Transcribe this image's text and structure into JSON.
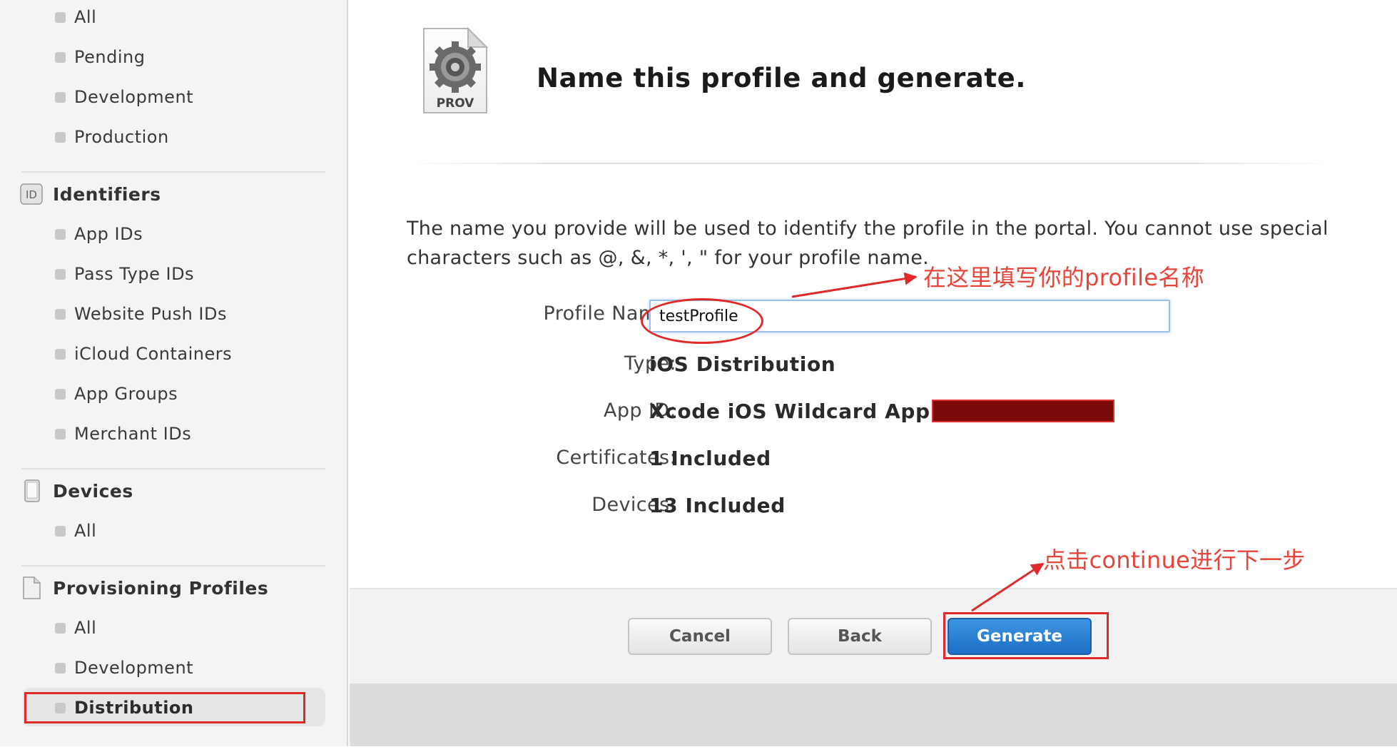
{
  "sidebar": {
    "top_items": [
      {
        "label": "All"
      },
      {
        "label": "Pending"
      },
      {
        "label": "Development"
      },
      {
        "label": "Production"
      }
    ],
    "identifiers": {
      "title": "Identifiers",
      "icon_text": "ID",
      "items": [
        {
          "label": "App IDs"
        },
        {
          "label": "Pass Type IDs"
        },
        {
          "label": "Website Push IDs"
        },
        {
          "label": "iCloud Containers"
        },
        {
          "label": "App Groups"
        },
        {
          "label": "Merchant IDs"
        }
      ]
    },
    "devices": {
      "title": "Devices",
      "items": [
        {
          "label": "All"
        }
      ]
    },
    "provisioning": {
      "title": "Provisioning Profiles",
      "items": [
        {
          "label": "All"
        },
        {
          "label": "Development"
        },
        {
          "label": "Distribution",
          "selected": true
        }
      ]
    }
  },
  "main": {
    "icon_label": "PROV",
    "heading": "Name this profile and generate.",
    "description": "The name you provide will be used to identify the profile in the portal. You cannot use special characters such as @, &, *, ', \" for your profile name.",
    "fields": {
      "profile_name_label": "Profile Name:",
      "profile_name_value": "testProfile",
      "type_label": "Type:",
      "type_value": "iOS Distribution",
      "app_id_label": "App ID:",
      "app_id_value": "Xcode iOS Wildcard App ID",
      "certificates_label": "Certificates:",
      "certificates_value": "1 Included",
      "devices_label": "Devices:",
      "devices_value": "13 Included"
    },
    "buttons": {
      "cancel": "Cancel",
      "back": "Back",
      "generate": "Generate"
    }
  },
  "annotations": {
    "name_hint": "在这里填写你的profile名称",
    "continue_hint": "点击continue进行下一步",
    "color": "#e8443a"
  },
  "colors": {
    "accent_blue": "#1d6fc6",
    "sidebar_bg": "#f4f4f4",
    "annotation_red": "#e02a2a"
  }
}
